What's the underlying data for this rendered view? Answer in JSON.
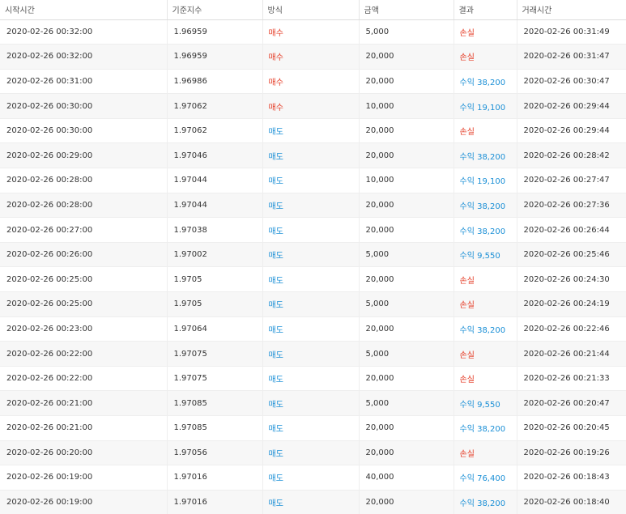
{
  "colors": {
    "buy": "#e53b25",
    "sell": "#1a8fd6",
    "loss": "#e53b25",
    "profit": "#1a8fd6"
  },
  "table": {
    "headers": [
      "시작시간",
      "기준지수",
      "방식",
      "금액",
      "결과",
      "거래시간"
    ],
    "rows": [
      [
        "2020-02-26 00:32:00",
        "1.96959",
        "매수",
        "5,000",
        "손실",
        "2020-02-26 00:31:49"
      ],
      [
        "2020-02-26 00:32:00",
        "1.96959",
        "매수",
        "20,000",
        "손실",
        "2020-02-26 00:31:47"
      ],
      [
        "2020-02-26 00:31:00",
        "1.96986",
        "매수",
        "20,000",
        "수익 38,200",
        "2020-02-26 00:30:47"
      ],
      [
        "2020-02-26 00:30:00",
        "1.97062",
        "매수",
        "10,000",
        "수익 19,100",
        "2020-02-26 00:29:44"
      ],
      [
        "2020-02-26 00:30:00",
        "1.97062",
        "매도",
        "20,000",
        "손실",
        "2020-02-26 00:29:44"
      ],
      [
        "2020-02-26 00:29:00",
        "1.97046",
        "매도",
        "20,000",
        "수익 38,200",
        "2020-02-26 00:28:42"
      ],
      [
        "2020-02-26 00:28:00",
        "1.97044",
        "매도",
        "10,000",
        "수익 19,100",
        "2020-02-26 00:27:47"
      ],
      [
        "2020-02-26 00:28:00",
        "1.97044",
        "매도",
        "20,000",
        "수익 38,200",
        "2020-02-26 00:27:36"
      ],
      [
        "2020-02-26 00:27:00",
        "1.97038",
        "매도",
        "20,000",
        "수익 38,200",
        "2020-02-26 00:26:44"
      ],
      [
        "2020-02-26 00:26:00",
        "1.97002",
        "매도",
        "5,000",
        "수익 9,550",
        "2020-02-26 00:25:46"
      ],
      [
        "2020-02-26 00:25:00",
        "1.9705",
        "매도",
        "20,000",
        "손실",
        "2020-02-26 00:24:30"
      ],
      [
        "2020-02-26 00:25:00",
        "1.9705",
        "매도",
        "5,000",
        "손실",
        "2020-02-26 00:24:19"
      ],
      [
        "2020-02-26 00:23:00",
        "1.97064",
        "매도",
        "20,000",
        "수익 38,200",
        "2020-02-26 00:22:46"
      ],
      [
        "2020-02-26 00:22:00",
        "1.97075",
        "매도",
        "5,000",
        "손실",
        "2020-02-26 00:21:44"
      ],
      [
        "2020-02-26 00:22:00",
        "1.97075",
        "매도",
        "20,000",
        "손실",
        "2020-02-26 00:21:33"
      ],
      [
        "2020-02-26 00:21:00",
        "1.97085",
        "매도",
        "5,000",
        "수익 9,550",
        "2020-02-26 00:20:47"
      ],
      [
        "2020-02-26 00:21:00",
        "1.97085",
        "매도",
        "20,000",
        "수익 38,200",
        "2020-02-26 00:20:45"
      ],
      [
        "2020-02-26 00:20:00",
        "1.97056",
        "매도",
        "20,000",
        "손실",
        "2020-02-26 00:19:26"
      ],
      [
        "2020-02-26 00:19:00",
        "1.97016",
        "매도",
        "40,000",
        "수익 76,400",
        "2020-02-26 00:18:43"
      ],
      [
        "2020-02-26 00:19:00",
        "1.97016",
        "매도",
        "20,000",
        "수익 38,200",
        "2020-02-26 00:18:40"
      ]
    ]
  }
}
